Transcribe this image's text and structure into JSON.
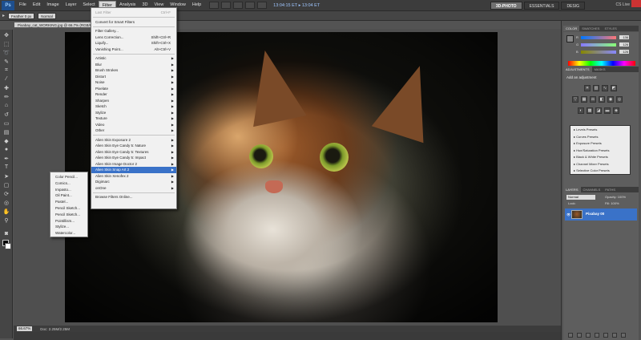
{
  "menubar": {
    "logo": "Ps",
    "items": [
      "File",
      "Edit",
      "Image",
      "Layer",
      "Select",
      "Filter",
      "Analysis",
      "3D",
      "View",
      "Window",
      "Help"
    ],
    "active": "Filter",
    "time": "13:04:15 ET ▸ 13:04 ET",
    "workspaces": [
      "3D-PHOTO",
      "ESSENTIALS",
      "DESIG"
    ],
    "active_workspace": "3D-PHOTO",
    "cs_live": "CS Live"
  },
  "options": {
    "tool_label": "Feather 0 px",
    "mode": "Normal"
  },
  "document": {
    "tab_title": "Pixabay_cat_WORKING.jpg @ 66.7% (RGB/8)"
  },
  "filter_menu": {
    "items": [
      {
        "label": "Last Filter",
        "shortcut": "Ctrl+F",
        "disabled": true
      },
      {
        "sep": true
      },
      {
        "label": "Convert for Smart Filters"
      },
      {
        "sep": true
      },
      {
        "label": "Filter Gallery..."
      },
      {
        "label": "Lens Correction...",
        "shortcut": "Shift+Ctrl+R"
      },
      {
        "label": "Liquify...",
        "shortcut": "Shift+Ctrl+X"
      },
      {
        "label": "Vanishing Point...",
        "shortcut": "Alt+Ctrl+V"
      },
      {
        "sep": true
      },
      {
        "label": "Artistic",
        "submenu": true
      },
      {
        "label": "Blur",
        "submenu": true
      },
      {
        "label": "Brush Strokes",
        "submenu": true
      },
      {
        "label": "Distort",
        "submenu": true
      },
      {
        "label": "Noise",
        "submenu": true
      },
      {
        "label": "Pixelate",
        "submenu": true
      },
      {
        "label": "Render",
        "submenu": true
      },
      {
        "label": "Sharpen",
        "submenu": true
      },
      {
        "label": "Sketch",
        "submenu": true
      },
      {
        "label": "Stylize",
        "submenu": true
      },
      {
        "label": "Texture",
        "submenu": true
      },
      {
        "label": "Video",
        "submenu": true
      },
      {
        "label": "Other",
        "submenu": true
      },
      {
        "sep": true
      },
      {
        "label": "Alien Skin Exposure 2",
        "submenu": true
      },
      {
        "label": "Alien Skin Eye Candy 5: Nature",
        "submenu": true
      },
      {
        "label": "Alien Skin Eye Candy 5: Textures",
        "submenu": true
      },
      {
        "label": "Alien Skin Eye Candy 5: Impact",
        "submenu": true
      },
      {
        "label": "Alien Skin Image Doctor 2",
        "submenu": true
      },
      {
        "label": "Alien Skin Snap Art 2",
        "submenu": true,
        "highlighted": true
      },
      {
        "label": "Alien Skin Xenofex 2",
        "submenu": true
      },
      {
        "label": "Digimarc",
        "submenu": true
      },
      {
        "label": "onOne",
        "submenu": true
      },
      {
        "sep": true
      },
      {
        "label": "Browse Filters Online..."
      }
    ]
  },
  "snapart_submenu": {
    "items": [
      "Color Pencil...",
      "Comics...",
      "Impasto...",
      "Oil Paint...",
      "Pastel...",
      "Pencil Sketch...",
      "Pencil Sketch...",
      "Pointillism...",
      "Stylize...",
      "Watercolor..."
    ]
  },
  "status": {
    "zoom": "66.67%",
    "doc_size": "Doc: 2.25M/2.25M"
  },
  "color_panel": {
    "tabs": [
      "COLOR",
      "SWATCHES",
      "STYLES"
    ],
    "labels": [
      "R",
      "G",
      "B"
    ],
    "values": [
      "136",
      "126",
      "126"
    ]
  },
  "adjustments_panel": {
    "tabs": [
      "ADJUSTMENTS",
      "MASKS"
    ],
    "title": "Add an adjustment",
    "presets": [
      "Levels Presets",
      "Curves Presets",
      "Exposure Presets",
      "Hue/Saturation Presets",
      "Black & White Presets",
      "Channel Mixer Presets",
      "Selective Color Presets"
    ]
  },
  "layers_panel": {
    "tabs": [
      "LAYERS",
      "CHANNELS",
      "PATHS"
    ],
    "blend_mode": "Normal",
    "opacity": "Opacity: 100%",
    "lock": "Lock:",
    "fill": "Fill: 100%",
    "layer_name": "Pixabay 00"
  }
}
